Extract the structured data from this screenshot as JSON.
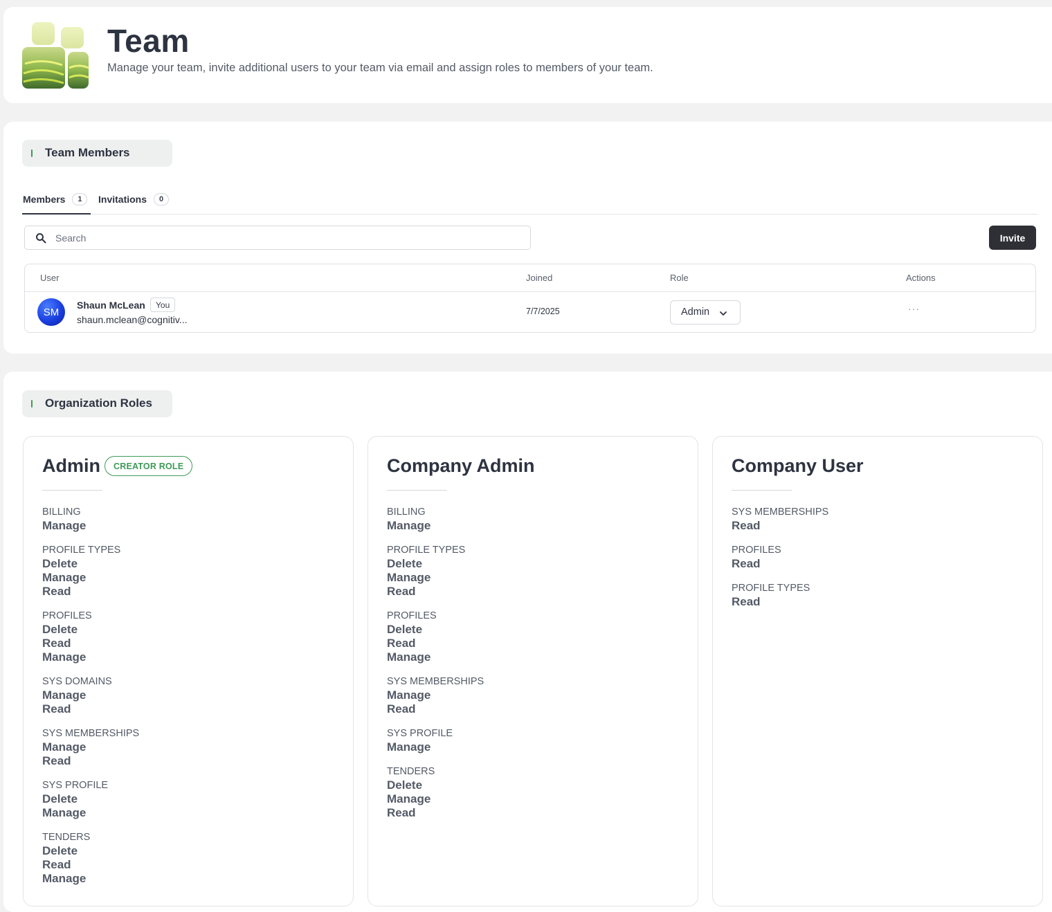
{
  "header": {
    "title": "Team",
    "description": "Manage your team, invite additional users to your team via email and assign roles to members of your team."
  },
  "team_members": {
    "section_title": "Team Members",
    "tabs": [
      {
        "label": "Members",
        "count": "1"
      },
      {
        "label": "Invitations",
        "count": "0"
      }
    ],
    "search_placeholder": "Search",
    "invite_label": "Invite",
    "columns": {
      "user": "User",
      "joined": "Joined",
      "role": "Role",
      "actions": "Actions"
    },
    "rows": [
      {
        "initials": "SM",
        "name": "Shaun McLean",
        "badge": "You",
        "email": "shaun.mclean@cognitiv...",
        "joined": "7/7/2025",
        "role": "Admin",
        "actions": "···"
      }
    ]
  },
  "organization_roles": {
    "section_title": "Organization Roles",
    "roles": [
      {
        "name": "Admin",
        "badge": "CREATOR ROLE",
        "permissions": [
          {
            "resource": "BILLING",
            "actions": [
              "Manage"
            ]
          },
          {
            "resource": "PROFILE TYPES",
            "actions": [
              "Delete",
              "Manage",
              "Read"
            ]
          },
          {
            "resource": "PROFILES",
            "actions": [
              "Delete",
              "Read",
              "Manage"
            ]
          },
          {
            "resource": "SYS DOMAINS",
            "actions": [
              "Manage",
              "Read"
            ]
          },
          {
            "resource": "SYS MEMBERSHIPS",
            "actions": [
              "Manage",
              "Read"
            ]
          },
          {
            "resource": "SYS PROFILE",
            "actions": [
              "Delete",
              "Manage"
            ]
          },
          {
            "resource": "TENDERS",
            "actions": [
              "Delete",
              "Read",
              "Manage"
            ]
          }
        ]
      },
      {
        "name": "Company Admin",
        "badge": "",
        "permissions": [
          {
            "resource": "BILLING",
            "actions": [
              "Manage"
            ]
          },
          {
            "resource": "PROFILE TYPES",
            "actions": [
              "Delete",
              "Manage",
              "Read"
            ]
          },
          {
            "resource": "PROFILES",
            "actions": [
              "Delete",
              "Read",
              "Manage"
            ]
          },
          {
            "resource": "SYS MEMBERSHIPS",
            "actions": [
              "Manage",
              "Read"
            ]
          },
          {
            "resource": "SYS PROFILE",
            "actions": [
              "Manage"
            ]
          },
          {
            "resource": "TENDERS",
            "actions": [
              "Delete",
              "Manage",
              "Read"
            ]
          }
        ]
      },
      {
        "name": "Company User",
        "badge": "",
        "permissions": [
          {
            "resource": "SYS MEMBERSHIPS",
            "actions": [
              "Read"
            ]
          },
          {
            "resource": "PROFILES",
            "actions": [
              "Read"
            ]
          },
          {
            "resource": "PROFILE TYPES",
            "actions": [
              "Read"
            ]
          }
        ]
      }
    ]
  },
  "colors": {
    "accent_green": "#3d9a57",
    "invite_button": "#2e3035",
    "avatar_blue": "#1a3fe0",
    "page_background": "#f2f2f2"
  },
  "icons": {
    "logo": "team-illustration-icon",
    "search": "search-icon",
    "role_dropdown": "chevron-down-icon"
  }
}
